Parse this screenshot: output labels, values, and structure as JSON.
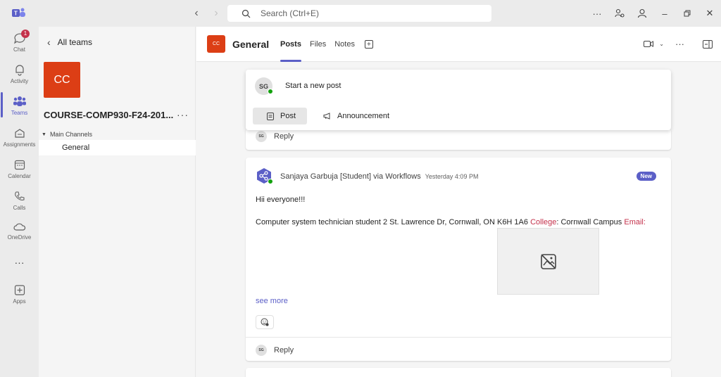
{
  "app": {
    "search_placeholder": "Search (Ctrl+E)",
    "accent": "#5b5fc7",
    "team_color": "#dc3e15"
  },
  "rail": {
    "items": [
      {
        "label": "Chat",
        "icon": "chat-icon",
        "badge": "1"
      },
      {
        "label": "Activity",
        "icon": "bell-icon"
      },
      {
        "label": "Teams",
        "icon": "teams-icon"
      },
      {
        "label": "Assignments",
        "icon": "assignments-icon"
      },
      {
        "label": "Calendar",
        "icon": "calendar-icon"
      },
      {
        "label": "Calls",
        "icon": "phone-icon"
      },
      {
        "label": "OneDrive",
        "icon": "cloud-icon"
      },
      {
        "label": "Apps",
        "icon": "apps-add-icon"
      }
    ]
  },
  "team_panel": {
    "back_label": "All teams",
    "avatar_initials": "CC",
    "team_name": "COURSE-COMP930-F24-201...",
    "section_label": "Main Channels",
    "channel": "General"
  },
  "channel_header": {
    "avatar_initials": "CC",
    "title": "General",
    "tabs": [
      "Posts",
      "Files",
      "Notes"
    ]
  },
  "new_post": {
    "avatar_initials": "SG",
    "prompt": "Start a new post",
    "post_label": "Post",
    "announcement_label": "Announcement"
  },
  "thread_top": {
    "avatar_initials": "SG",
    "reply_label": "Reply"
  },
  "message": {
    "author": "Sanjaya Garbuja [Student] via Workflows",
    "time": "Yesterday 4:09 PM",
    "new_badge": "New",
    "line1": "Hii everyone!!!",
    "line2_a": "Computer system technician student 2 St. Lawrence Dr, Cornwall, ON K6H 1A6 ",
    "line2_college": "College",
    "line2_b": ": Cornwall Campus ",
    "line2_email": "Email:",
    "see_more": "see more",
    "reply_avatar": "SG",
    "reply_label": "Reply"
  }
}
